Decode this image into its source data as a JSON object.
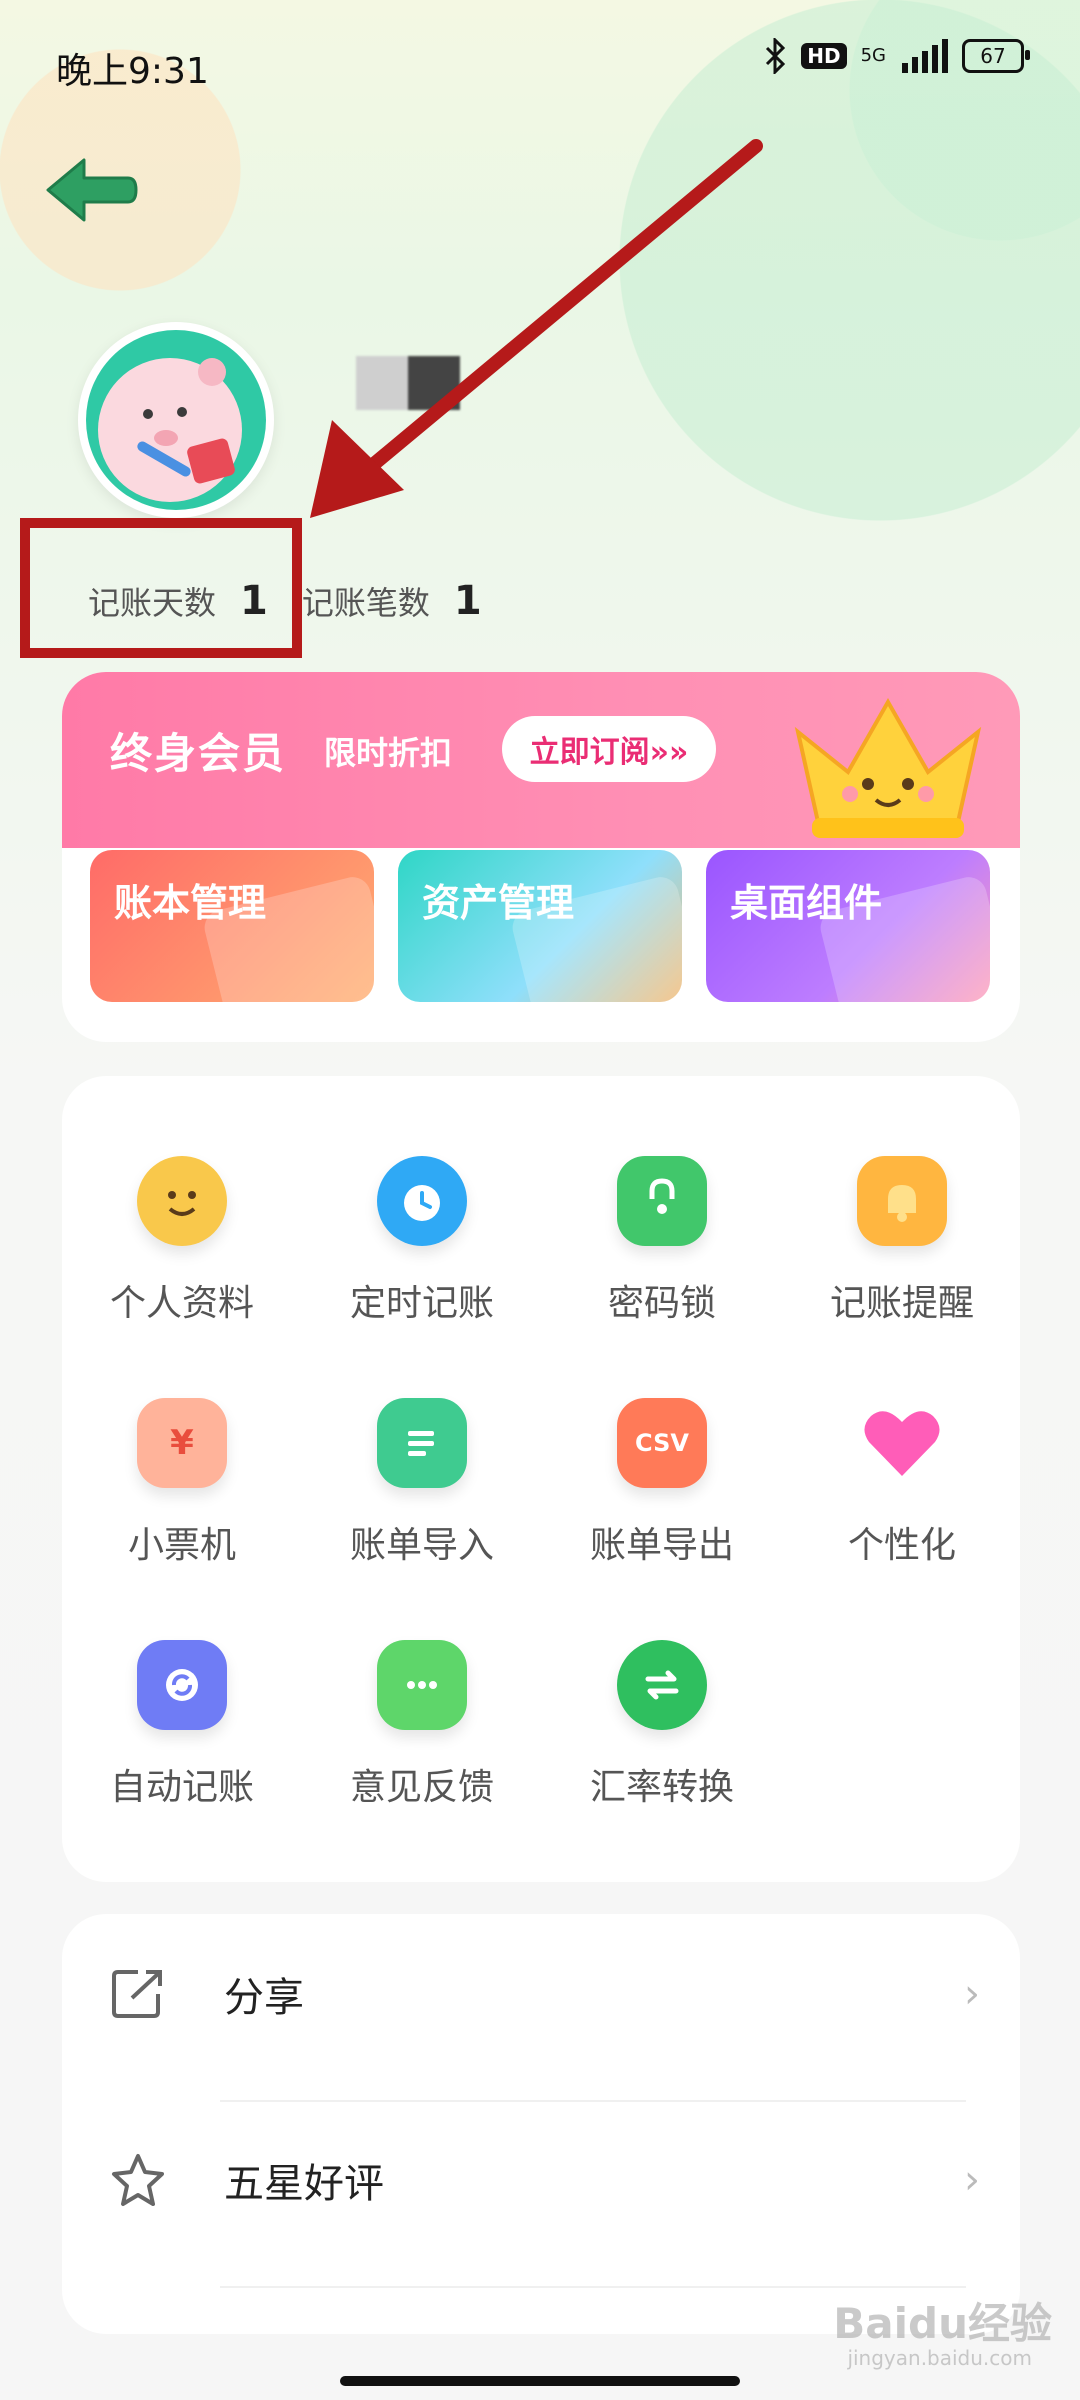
{
  "status_bar": {
    "time": "晚上9:31",
    "hd_label": "HD",
    "network": "5G",
    "battery": "67"
  },
  "profile": {
    "stats": [
      {
        "label": "记账天数",
        "value": "1"
      },
      {
        "label": "记账笔数",
        "value": "1"
      }
    ]
  },
  "membership": {
    "title": "终身会员",
    "discount": "限时折扣",
    "subscribe_label": "立即订阅»»"
  },
  "feature_cards": [
    {
      "label": "账本管理"
    },
    {
      "label": "资产管理"
    },
    {
      "label": "桌面组件"
    }
  ],
  "grid": [
    {
      "label": "个人资料",
      "icon": "smiley-icon",
      "color": "#f9c84b"
    },
    {
      "label": "定时记账",
      "icon": "alarm-clock-icon",
      "color": "#2fa9f5"
    },
    {
      "label": "密码锁",
      "icon": "lock-icon",
      "color": "#41c76b"
    },
    {
      "label": "记账提醒",
      "icon": "bell-icon",
      "color": "#ffb640"
    },
    {
      "label": "小票机",
      "icon": "receipt-icon",
      "color": "#ffb39a"
    },
    {
      "label": "账单导入",
      "icon": "bill-import-icon",
      "color": "#3fcb90"
    },
    {
      "label": "账单导出",
      "icon": "csv-export-icon",
      "color": "#ff7a58"
    },
    {
      "label": "个性化",
      "icon": "heart-icon",
      "color": "#ff5db8"
    },
    {
      "label": "自动记账",
      "icon": "refresh-icon",
      "color": "#6f7cf5"
    },
    {
      "label": "意见反馈",
      "icon": "chat-bubble-icon",
      "color": "#5ed66a"
    },
    {
      "label": "汇率转换",
      "icon": "exchange-icon",
      "color": "#2fbf5f"
    }
  ],
  "grid_glyphs": {
    "receipt": "¥",
    "csv": "CSV"
  },
  "list": [
    {
      "label": "分享",
      "icon": "share-icon"
    },
    {
      "label": "五星好评",
      "icon": "star-icon"
    }
  ],
  "list_chevron": "›",
  "watermark": {
    "brand": "Baidu经验",
    "url": "jingyan.baidu.com"
  },
  "colors": {
    "annotation_red": "#b51a1a",
    "back_arrow": "#2e9f62",
    "member_pink": "#ff7aa7"
  }
}
